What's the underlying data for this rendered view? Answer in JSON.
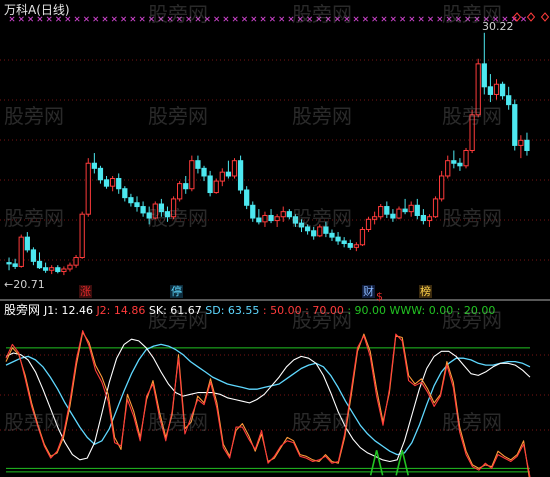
{
  "header": {
    "title": "万科A",
    "period": "(日线)"
  },
  "price_chart": {
    "high_label": "30.22",
    "low_label": "←20.71",
    "markers": [
      {
        "text": "涨",
        "color": "#e02a2a",
        "bg": "#3b0d0d"
      },
      {
        "text": "停",
        "color": "#5fd8ff",
        "bg": "#0d2b3b"
      },
      {
        "text": "财",
        "color": "#8ab8ff",
        "bg": "#101c3b"
      },
      {
        "text": "$",
        "color": "#e02a2a",
        "bg": ""
      },
      {
        "text": "榜",
        "color": "#ffd24a",
        "bg": "#3b2a0d"
      }
    ],
    "colors": {
      "up": "#ff3b3b",
      "down": "#4de8f0",
      "cross_left": "#cc44cc",
      "cross_right": "#cc44cc",
      "diamond": "#ff3b3b"
    }
  },
  "indicator": {
    "label": "股旁网",
    "values": [
      {
        "text": "J1: 12.46",
        "color": "#ffffff"
      },
      {
        "text": "J2: 14.86",
        "color": "#ff3b3b"
      },
      {
        "text": "SK: 61.67",
        "color": "#ffffff"
      },
      {
        "text": "SD: 63.55",
        "color": "#5fd8ff"
      },
      {
        "text": ": 50.00",
        "color": "#ff3b3b"
      },
      {
        "text": ": 70.00",
        "color": "#ff3b3b"
      },
      {
        "text": ": 90.00",
        "color": "#22c322"
      },
      {
        "text": "WWW: 0.00",
        "color": "#22c322"
      },
      {
        "text": ": 20.00",
        "color": "#22c322"
      }
    ],
    "levels": [
      20,
      50,
      70,
      90
    ],
    "colors": {
      "sk": "#ffffff",
      "sd": "#5fd8ff",
      "j1": "#ff9a3a",
      "j2": "#ff3b3b",
      "level": "#22c322",
      "www": "#22c322"
    }
  },
  "watermark": "股旁网",
  "chart_data": [
    {
      "type": "candlestick",
      "title": "万科A (日线)",
      "y_max_label": 30.22,
      "y_min_label": 20.71,
      "ylim": [
        20.4,
        30.8
      ],
      "candles": [
        [
          21.2,
          21.4,
          20.9,
          21.15
        ],
        [
          21.15,
          21.35,
          20.95,
          21.05
        ],
        [
          21.05,
          22.3,
          21.0,
          22.2
        ],
        [
          22.2,
          22.4,
          21.6,
          21.7
        ],
        [
          21.7,
          21.8,
          21.1,
          21.25
        ],
        [
          21.25,
          21.6,
          20.95,
          21.0
        ],
        [
          21.0,
          21.2,
          20.8,
          20.9
        ],
        [
          20.9,
          21.1,
          20.75,
          21.0
        ],
        [
          21.0,
          21.1,
          20.78,
          20.85
        ],
        [
          20.85,
          21.05,
          20.71,
          20.95
        ],
        [
          20.95,
          21.2,
          20.85,
          21.1
        ],
        [
          21.1,
          21.5,
          21.0,
          21.4
        ],
        [
          21.4,
          23.2,
          21.35,
          23.1
        ],
        [
          23.1,
          25.3,
          23.0,
          25.1
        ],
        [
          25.1,
          25.5,
          24.7,
          24.9
        ],
        [
          24.9,
          25.0,
          24.3,
          24.45
        ],
        [
          24.45,
          24.6,
          24.1,
          24.2
        ],
        [
          24.2,
          24.6,
          24.0,
          24.5
        ],
        [
          24.5,
          24.7,
          23.9,
          24.1
        ],
        [
          24.1,
          24.2,
          23.6,
          23.75
        ],
        [
          23.75,
          23.9,
          23.4,
          23.55
        ],
        [
          23.55,
          23.8,
          23.2,
          23.4
        ],
        [
          23.4,
          23.6,
          23.0,
          23.15
        ],
        [
          23.15,
          23.4,
          22.7,
          22.95
        ],
        [
          22.95,
          23.6,
          22.9,
          23.5
        ],
        [
          23.5,
          23.7,
          23.0,
          23.2
        ],
        [
          23.2,
          23.4,
          22.8,
          23.0
        ],
        [
          23.0,
          23.8,
          22.9,
          23.7
        ],
        [
          23.7,
          24.4,
          23.6,
          24.3
        ],
        [
          24.3,
          24.6,
          23.9,
          24.1
        ],
        [
          24.1,
          25.4,
          24.0,
          25.2
        ],
        [
          25.2,
          25.4,
          24.7,
          24.9
        ],
        [
          24.9,
          25.0,
          24.4,
          24.6
        ],
        [
          24.6,
          24.8,
          23.8,
          23.95
        ],
        [
          23.95,
          24.5,
          23.9,
          24.4
        ],
        [
          24.4,
          24.9,
          24.2,
          24.75
        ],
        [
          24.75,
          25.2,
          24.5,
          24.6
        ],
        [
          24.6,
          25.3,
          24.5,
          25.2
        ],
        [
          25.2,
          25.4,
          23.9,
          24.05
        ],
        [
          24.05,
          24.2,
          23.3,
          23.45
        ],
        [
          23.45,
          23.6,
          22.8,
          22.95
        ],
        [
          22.95,
          23.3,
          22.7,
          22.8
        ],
        [
          22.8,
          23.2,
          22.6,
          23.05
        ],
        [
          23.05,
          23.3,
          22.75,
          22.85
        ],
        [
          22.85,
          23.1,
          22.6,
          23.0
        ],
        [
          23.0,
          23.4,
          22.8,
          23.2
        ],
        [
          23.2,
          23.3,
          22.9,
          23.0
        ],
        [
          23.0,
          23.1,
          22.6,
          22.75
        ],
        [
          22.75,
          22.9,
          22.4,
          22.6
        ],
        [
          22.6,
          22.7,
          22.3,
          22.45
        ],
        [
          22.45,
          22.6,
          22.1,
          22.25
        ],
        [
          22.25,
          22.7,
          22.2,
          22.6
        ],
        [
          22.6,
          22.8,
          22.2,
          22.35
        ],
        [
          22.35,
          22.5,
          22.05,
          22.2
        ],
        [
          22.2,
          22.4,
          21.9,
          22.05
        ],
        [
          22.05,
          22.2,
          21.8,
          21.95
        ],
        [
          21.95,
          22.1,
          21.7,
          21.8
        ],
        [
          21.8,
          22.0,
          21.65,
          21.9
        ],
        [
          21.9,
          22.6,
          21.85,
          22.5
        ],
        [
          22.5,
          23.0,
          22.4,
          22.9
        ],
        [
          22.9,
          23.2,
          22.7,
          23.0
        ],
        [
          23.0,
          23.5,
          22.9,
          23.4
        ],
        [
          23.4,
          23.6,
          22.95,
          23.1
        ],
        [
          23.1,
          23.3,
          22.8,
          22.95
        ],
        [
          22.95,
          23.4,
          22.9,
          23.3
        ],
        [
          23.3,
          23.7,
          23.1,
          23.2
        ],
        [
          23.2,
          23.6,
          23.0,
          23.45
        ],
        [
          23.45,
          23.7,
          22.9,
          23.05
        ],
        [
          23.05,
          23.3,
          22.7,
          22.85
        ],
        [
          22.85,
          23.1,
          22.6,
          23.0
        ],
        [
          23.0,
          23.8,
          22.95,
          23.7
        ],
        [
          23.7,
          24.8,
          23.6,
          24.6
        ],
        [
          24.6,
          25.4,
          24.5,
          25.2
        ],
        [
          25.2,
          25.6,
          24.9,
          25.1
        ],
        [
          25.1,
          25.3,
          24.8,
          25.0
        ],
        [
          25.0,
          25.7,
          24.9,
          25.6
        ],
        [
          25.6,
          27.2,
          25.5,
          27.0
        ],
        [
          27.0,
          29.2,
          26.9,
          29.0
        ],
        [
          29.0,
          30.22,
          27.8,
          28.1
        ],
        [
          28.1,
          28.6,
          27.5,
          27.8
        ],
        [
          27.8,
          28.4,
          27.6,
          28.2
        ],
        [
          28.2,
          28.3,
          27.6,
          27.75
        ],
        [
          27.75,
          28.1,
          27.2,
          27.4
        ],
        [
          27.4,
          27.6,
          25.6,
          25.8
        ],
        [
          25.8,
          26.2,
          25.3,
          26.0
        ],
        [
          26.0,
          26.3,
          25.4,
          25.6
        ]
      ]
    },
    {
      "type": "line",
      "title": "",
      "ylim": [
        15,
        105
      ],
      "levels": [
        20,
        50,
        70,
        90
      ],
      "series": [
        {
          "name": "SK",
          "values": [
            85,
            87,
            86,
            83,
            76,
            66,
            55,
            44,
            35,
            28,
            25,
            26,
            35,
            52,
            70,
            84,
            92,
            95,
            94,
            90,
            84,
            76,
            69,
            64,
            62,
            63,
            64,
            64,
            64,
            63,
            61,
            60,
            59,
            58,
            60,
            63,
            68,
            73,
            79,
            83,
            85,
            84,
            81,
            74,
            64,
            53,
            44,
            37,
            32,
            29,
            27,
            25,
            24,
            25,
            36,
            51,
            66,
            78,
            85,
            88,
            88,
            85,
            80,
            75,
            74,
            76,
            79,
            81,
            81,
            80,
            77,
            73
          ]
        },
        {
          "name": "SD",
          "values": [
            80,
            82,
            84,
            85,
            83,
            79,
            73,
            66,
            58,
            51,
            44,
            38,
            34,
            36,
            43,
            54,
            65,
            75,
            83,
            89,
            91,
            92,
            91,
            89,
            86,
            82,
            79,
            76,
            73,
            71,
            69,
            68,
            67,
            66,
            66,
            67,
            68,
            69,
            72,
            75,
            78,
            80,
            81,
            79,
            74,
            67,
            59,
            52,
            45,
            40,
            36,
            33,
            30,
            28,
            29,
            35,
            45,
            57,
            68,
            76,
            81,
            84,
            84,
            83,
            81,
            80,
            80,
            81,
            82,
            82,
            81,
            79
          ]
        },
        {
          "name": "J1",
          "values": [
            82,
            90,
            86,
            74,
            58,
            45,
            34,
            27,
            29,
            38,
            56,
            80,
            99,
            93,
            80,
            73,
            63,
            38,
            31,
            63,
            53,
            38,
            60,
            71,
            53,
            38,
            51,
            86,
            43,
            47,
            62,
            58,
            72,
            58,
            34,
            27,
            42,
            46,
            39,
            30,
            40,
            24,
            26,
            32,
            38,
            36,
            28,
            27,
            25,
            24,
            28,
            24,
            23,
            38,
            62,
            88,
            98,
            88,
            66,
            47,
            64,
            97,
            96,
            74,
            69,
            72,
            66,
            58,
            63,
            82,
            70,
            44,
            30,
            22,
            20,
            22,
            21,
            30,
            27,
            25,
            28,
            36,
            12
          ]
        },
        {
          "name": "J2",
          "values": [
            84,
            92,
            87,
            72,
            56,
            44,
            33,
            26,
            30,
            40,
            59,
            83,
            100,
            91,
            77,
            70,
            59,
            35,
            33,
            60,
            50,
            36,
            62,
            69,
            50,
            36,
            53,
            84,
            40,
            50,
            60,
            57,
            70,
            55,
            32,
            26,
            44,
            44,
            37,
            31,
            42,
            23,
            27,
            33,
            36,
            35,
            27,
            26,
            24,
            25,
            27,
            23,
            24,
            40,
            65,
            90,
            97,
            85,
            62,
            45,
            66,
            98,
            94,
            71,
            68,
            70,
            64,
            56,
            62,
            80,
            67,
            41,
            28,
            21,
            19,
            23,
            20,
            28,
            26,
            24,
            27,
            34,
            15
          ]
        },
        {
          "name": "WWW",
          "values": [
            0,
            0,
            0,
            0,
            0,
            0,
            0,
            0,
            0,
            0,
            0,
            0,
            0,
            0,
            0,
            0,
            0,
            0,
            0,
            0,
            0,
            0,
            0,
            0,
            0,
            0,
            0,
            0,
            0,
            0,
            0,
            0,
            0,
            0,
            0,
            0,
            0,
            0,
            0,
            0,
            0,
            0,
            0,
            0,
            0,
            0,
            0,
            0,
            0,
            0,
            0,
            0,
            0,
            0,
            0,
            0,
            0,
            0,
            20,
            0,
            0,
            0,
            20,
            0,
            0,
            0,
            0,
            0,
            0,
            0,
            0,
            0,
            0,
            0,
            0,
            0,
            0,
            0,
            0,
            0,
            0,
            0,
            0
          ]
        }
      ]
    }
  ]
}
